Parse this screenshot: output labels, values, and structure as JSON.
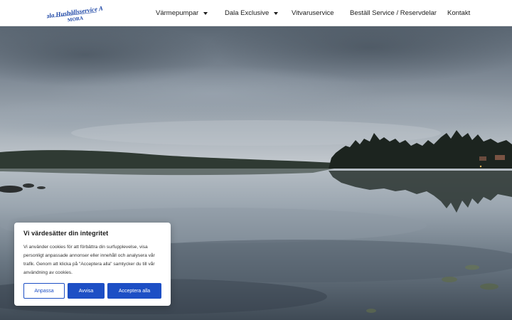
{
  "logo": {
    "line1": "Dala Hushållsservice AB",
    "line2": "MORA"
  },
  "nav": {
    "items": [
      {
        "label": "Värmepumpar",
        "has_dropdown": true
      },
      {
        "label": "Dala Exclusive",
        "has_dropdown": true
      },
      {
        "label": "Vitvaruservice",
        "has_dropdown": false
      },
      {
        "label": "Beställ Service / Reservdelar",
        "has_dropdown": false
      },
      {
        "label": "Kontakt",
        "has_dropdown": false
      }
    ]
  },
  "cookie_banner": {
    "title": "Vi värdesätter din integritet",
    "text": "Vi använder cookies för att förbättra din surfupplevelse, visa personligt anpassade annonser eller innehåll och analysera vår trafik. Genom att klicka på \"Acceptera alla\" samtycker du till vår användning av cookies.",
    "buttons": {
      "customize": "Anpassa",
      "reject": "Avvisa",
      "accept": "Acceptera alla"
    }
  },
  "colors": {
    "accent": "#1d4fc5",
    "logo_blue": "#1e47a6"
  }
}
